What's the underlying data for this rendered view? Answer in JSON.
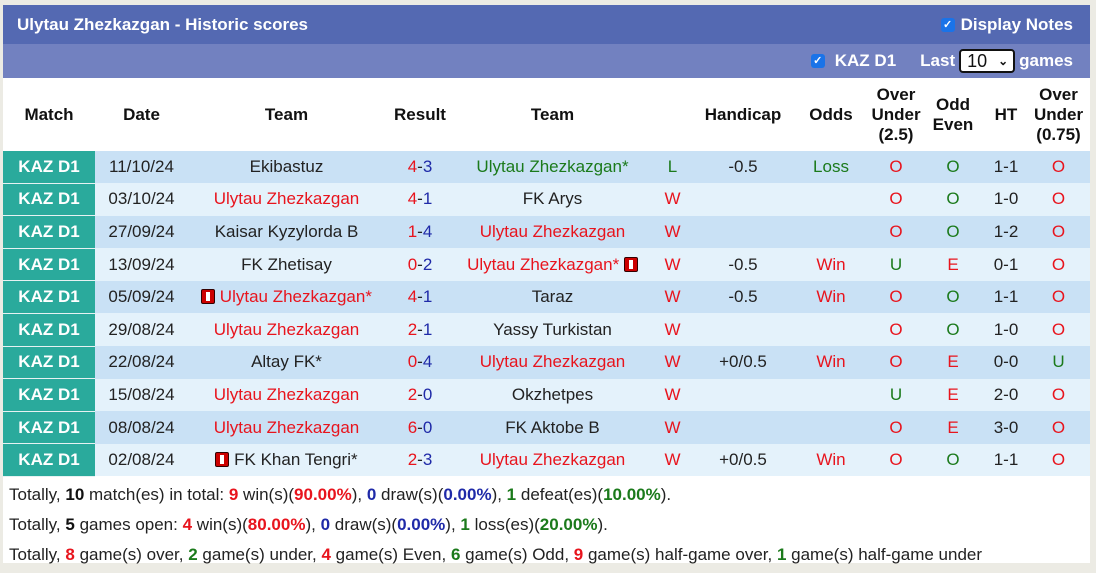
{
  "header": {
    "title": "Ulytau Zhezkazgan - Historic scores",
    "display_notes_label": "Display Notes",
    "display_notes_checked": true
  },
  "filter": {
    "league_label": "KAZ D1",
    "league_checked": true,
    "last_label": "Last",
    "games_count": "10",
    "games_label": "games"
  },
  "columns": [
    "Match",
    "Date",
    "Team",
    "Result",
    "Team",
    "",
    "Handicap",
    "Odds",
    "Over Under (2.5)",
    "Odd Even",
    "HT",
    "Over Under (0.75)"
  ],
  "rows": [
    {
      "league": "KAZ D1",
      "date": "11/10/24",
      "home": "Ekibastuz",
      "home_color": "dark",
      "home_flag": false,
      "score_home": "4",
      "score_away": "3",
      "away": "Ulytau Zhezkazgan*",
      "away_color": "green",
      "away_flag": false,
      "result": "L",
      "result_color": "green",
      "handicap": "-0.5",
      "odds": "Loss",
      "odds_color": "green",
      "ou": "O",
      "ou_color": "red",
      "oe": "O",
      "oe_color": "green",
      "ht": "1-1",
      "ou2": "O",
      "ou2_color": "red"
    },
    {
      "league": "KAZ D1",
      "date": "03/10/24",
      "home": "Ulytau Zhezkazgan",
      "home_color": "red",
      "home_flag": false,
      "score_home": "4",
      "score_away": "1",
      "away": "FK Arys",
      "away_color": "dark",
      "away_flag": false,
      "result": "W",
      "result_color": "red",
      "handicap": "",
      "odds": "",
      "odds_color": "red",
      "ou": "O",
      "ou_color": "red",
      "oe": "O",
      "oe_color": "green",
      "ht": "1-0",
      "ou2": "O",
      "ou2_color": "red"
    },
    {
      "league": "KAZ D1",
      "date": "27/09/24",
      "home": "Kaisar Kyzylorda B",
      "home_color": "dark",
      "home_flag": false,
      "score_home": "1",
      "score_away": "4",
      "away": "Ulytau Zhezkazgan",
      "away_color": "red",
      "away_flag": false,
      "result": "W",
      "result_color": "red",
      "handicap": "",
      "odds": "",
      "odds_color": "red",
      "ou": "O",
      "ou_color": "red",
      "oe": "O",
      "oe_color": "green",
      "ht": "1-2",
      "ou2": "O",
      "ou2_color": "red"
    },
    {
      "league": "KAZ D1",
      "date": "13/09/24",
      "home": "FK Zhetisay",
      "home_color": "dark",
      "home_flag": false,
      "score_home": "0",
      "score_away": "2",
      "away": "Ulytau Zhezkazgan*",
      "away_color": "red",
      "away_flag": true,
      "result": "W",
      "result_color": "red",
      "handicap": "-0.5",
      "odds": "Win",
      "odds_color": "red",
      "ou": "U",
      "ou_color": "green",
      "oe": "E",
      "oe_color": "red",
      "ht": "0-1",
      "ou2": "O",
      "ou2_color": "red"
    },
    {
      "league": "KAZ D1",
      "date": "05/09/24",
      "home": "Ulytau Zhezkazgan*",
      "home_color": "red",
      "home_flag": true,
      "score_home": "4",
      "score_away": "1",
      "away": "Taraz",
      "away_color": "dark",
      "away_flag": false,
      "result": "W",
      "result_color": "red",
      "handicap": "-0.5",
      "odds": "Win",
      "odds_color": "red",
      "ou": "O",
      "ou_color": "red",
      "oe": "O",
      "oe_color": "green",
      "ht": "1-1",
      "ou2": "O",
      "ou2_color": "red"
    },
    {
      "league": "KAZ D1",
      "date": "29/08/24",
      "home": "Ulytau Zhezkazgan",
      "home_color": "red",
      "home_flag": false,
      "score_home": "2",
      "score_away": "1",
      "away": "Yassy Turkistan",
      "away_color": "dark",
      "away_flag": false,
      "result": "W",
      "result_color": "red",
      "handicap": "",
      "odds": "",
      "odds_color": "red",
      "ou": "O",
      "ou_color": "red",
      "oe": "O",
      "oe_color": "green",
      "ht": "1-0",
      "ou2": "O",
      "ou2_color": "red"
    },
    {
      "league": "KAZ D1",
      "date": "22/08/24",
      "home": "Altay FK*",
      "home_color": "dark",
      "home_flag": false,
      "score_home": "0",
      "score_away": "4",
      "away": "Ulytau Zhezkazgan",
      "away_color": "red",
      "away_flag": false,
      "result": "W",
      "result_color": "red",
      "handicap": "+0/0.5",
      "odds": "Win",
      "odds_color": "red",
      "ou": "O",
      "ou_color": "red",
      "oe": "E",
      "oe_color": "red",
      "ht": "0-0",
      "ou2": "U",
      "ou2_color": "green"
    },
    {
      "league": "KAZ D1",
      "date": "15/08/24",
      "home": "Ulytau Zhezkazgan",
      "home_color": "red",
      "home_flag": false,
      "score_home": "2",
      "score_away": "0",
      "away": "Okzhetpes",
      "away_color": "dark",
      "away_flag": false,
      "result": "W",
      "result_color": "red",
      "handicap": "",
      "odds": "",
      "odds_color": "red",
      "ou": "U",
      "ou_color": "green",
      "oe": "E",
      "oe_color": "red",
      "ht": "2-0",
      "ou2": "O",
      "ou2_color": "red"
    },
    {
      "league": "KAZ D1",
      "date": "08/08/24",
      "home": "Ulytau Zhezkazgan",
      "home_color": "red",
      "home_flag": false,
      "score_home": "6",
      "score_away": "0",
      "away": "FK Aktobe B",
      "away_color": "dark",
      "away_flag": false,
      "result": "W",
      "result_color": "red",
      "handicap": "",
      "odds": "",
      "odds_color": "red",
      "ou": "O",
      "ou_color": "red",
      "oe": "E",
      "oe_color": "red",
      "ht": "3-0",
      "ou2": "O",
      "ou2_color": "red"
    },
    {
      "league": "KAZ D1",
      "date": "02/08/24",
      "home": "FK Khan Tengri*",
      "home_color": "dark",
      "home_flag": true,
      "score_home": "2",
      "score_away": "3",
      "away": "Ulytau Zhezkazgan",
      "away_color": "red",
      "away_flag": false,
      "result": "W",
      "result_color": "red",
      "handicap": "+0/0.5",
      "odds": "Win",
      "odds_color": "red",
      "ou": "O",
      "ou_color": "red",
      "oe": "O",
      "oe_color": "green",
      "ht": "1-1",
      "ou2": "O",
      "ou2_color": "red"
    }
  ],
  "summary": {
    "line1": {
      "prefix": "Totally, ",
      "total": "10",
      "t1": " match(es) in total: ",
      "wins": "9",
      "t2": " win(s)(",
      "win_pct": "90.00%",
      "t3": "), ",
      "draws": "0",
      "t4": " draw(s)(",
      "draw_pct": "0.00%",
      "t5": "), ",
      "losses": "1",
      "t6": " defeat(es)(",
      "loss_pct": "10.00%",
      "t7": ")."
    },
    "line2": {
      "prefix": "Totally, ",
      "total": "5",
      "t1": " games open: ",
      "wins": "4",
      "t2": " win(s)(",
      "win_pct": "80.00%",
      "t3": "), ",
      "draws": "0",
      "t4": " draw(s)(",
      "draw_pct": "0.00%",
      "t5": "), ",
      "losses": "1",
      "t6": " loss(es)(",
      "loss_pct": "20.00%",
      "t7": ")."
    },
    "line3": {
      "prefix": "Totally, ",
      "over": "8",
      "t1": " game(s) over, ",
      "under": "2",
      "t2": " game(s) under, ",
      "even": "4",
      "t3": " game(s) Even, ",
      "odd": "6",
      "t4": " game(s) Odd, ",
      "hg_over": "9",
      "t5": " game(s) half-game over, ",
      "hg_under": "1",
      "t6": " game(s) half-game under"
    }
  }
}
